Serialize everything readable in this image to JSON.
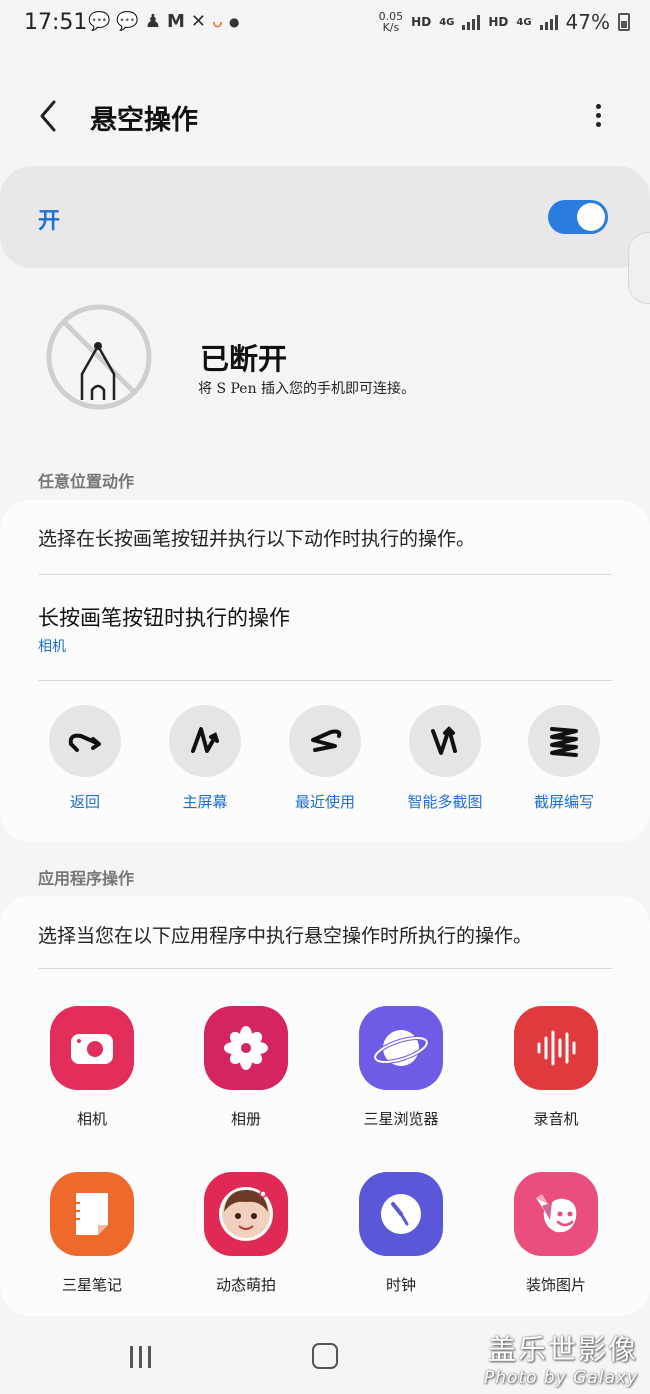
{
  "status_bar": {
    "time": "17:51",
    "notification_icons": [
      "wechat-icon",
      "wechat-icon",
      "app-icon",
      "gmail-icon",
      "x-icon",
      "didi-icon",
      "more-dot-icon"
    ],
    "speed_value": "0.05",
    "speed_unit": "K/s",
    "hd1": "HD",
    "net1": "4G",
    "hd2": "HD",
    "net2": "4G",
    "battery_pct": "47%"
  },
  "header": {
    "title": "悬空操作"
  },
  "master_switch": {
    "label": "开",
    "on": true
  },
  "spen_status": {
    "title": "已断开",
    "subtitle": "将 S Pen 插入您的手机即可连接。"
  },
  "anywhere": {
    "section_label": "任意位置动作",
    "description": "选择在长按画笔按钮并执行以下动作时执行的操作。",
    "long_press_title": "长按画笔按钮时执行的操作",
    "long_press_value": "相机",
    "gestures": [
      {
        "label": "返回",
        "icon": "gesture-back-icon"
      },
      {
        "label": "主屏幕",
        "icon": "gesture-home-icon"
      },
      {
        "label": "最近使用",
        "icon": "gesture-recent-icon"
      },
      {
        "label": "智能多截图",
        "icon": "gesture-smart-select-icon"
      },
      {
        "label": "截屏编写",
        "icon": "gesture-screen-write-icon"
      }
    ]
  },
  "apps_section": {
    "section_label": "应用程序操作",
    "description": "选择当您在以下应用程序中执行悬空操作时所执行的操作。",
    "apps": [
      {
        "label": "相机",
        "icon": "camera-icon",
        "color": "#e32d5a"
      },
      {
        "label": "相册",
        "icon": "gallery-icon",
        "color": "#d6245e"
      },
      {
        "label": "三星浏览器",
        "icon": "internet-icon",
        "color": "#6f5ce6"
      },
      {
        "label": "录音机",
        "icon": "voice-recorder-icon",
        "color": "#e0393e"
      },
      {
        "label": "三星笔记",
        "icon": "notes-icon",
        "color": "#ee6a2c"
      },
      {
        "label": "动态萌拍",
        "icon": "ar-emoji-icon",
        "color": "#e02955"
      },
      {
        "label": "时钟",
        "icon": "clock-icon",
        "color": "#5a57d9"
      },
      {
        "label": "装饰图片",
        "icon": "pen-up-icon",
        "color": "#e94e7c"
      }
    ]
  },
  "watermark": {
    "line1": "盖乐世影像",
    "line2": "Photo by Galaxy"
  }
}
